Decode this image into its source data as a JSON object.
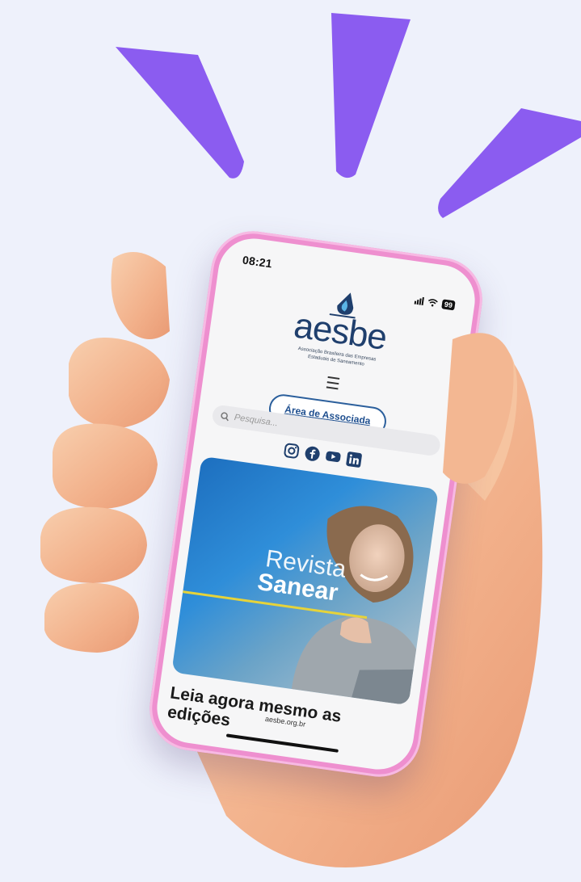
{
  "colors": {
    "background": "#eef1fb",
    "burst": "#8b5cf0",
    "phone_frame": "#ee8fcf",
    "skin": "#f4b992",
    "brand": "#1f3f6d",
    "accent_line": "#e6d33a"
  },
  "status": {
    "time": "08:21",
    "battery": "99"
  },
  "logo": {
    "word": "aesbe",
    "subtitle_line1": "Associação Brasileira das Empresas",
    "subtitle_line2": "Estaduais de Saneamento"
  },
  "menu_icon": "hamburger-icon",
  "associate_button": "Área de Associada",
  "search": {
    "placeholder": "Pesquisa..."
  },
  "social_icons": [
    "instagram-icon",
    "facebook-icon",
    "youtube-icon",
    "linkedin-icon"
  ],
  "banner": {
    "title_line1": "Revista",
    "title_line2": "Sanear"
  },
  "headline": "Leia agora mesmo as edições",
  "url": "aesbe.org.br"
}
